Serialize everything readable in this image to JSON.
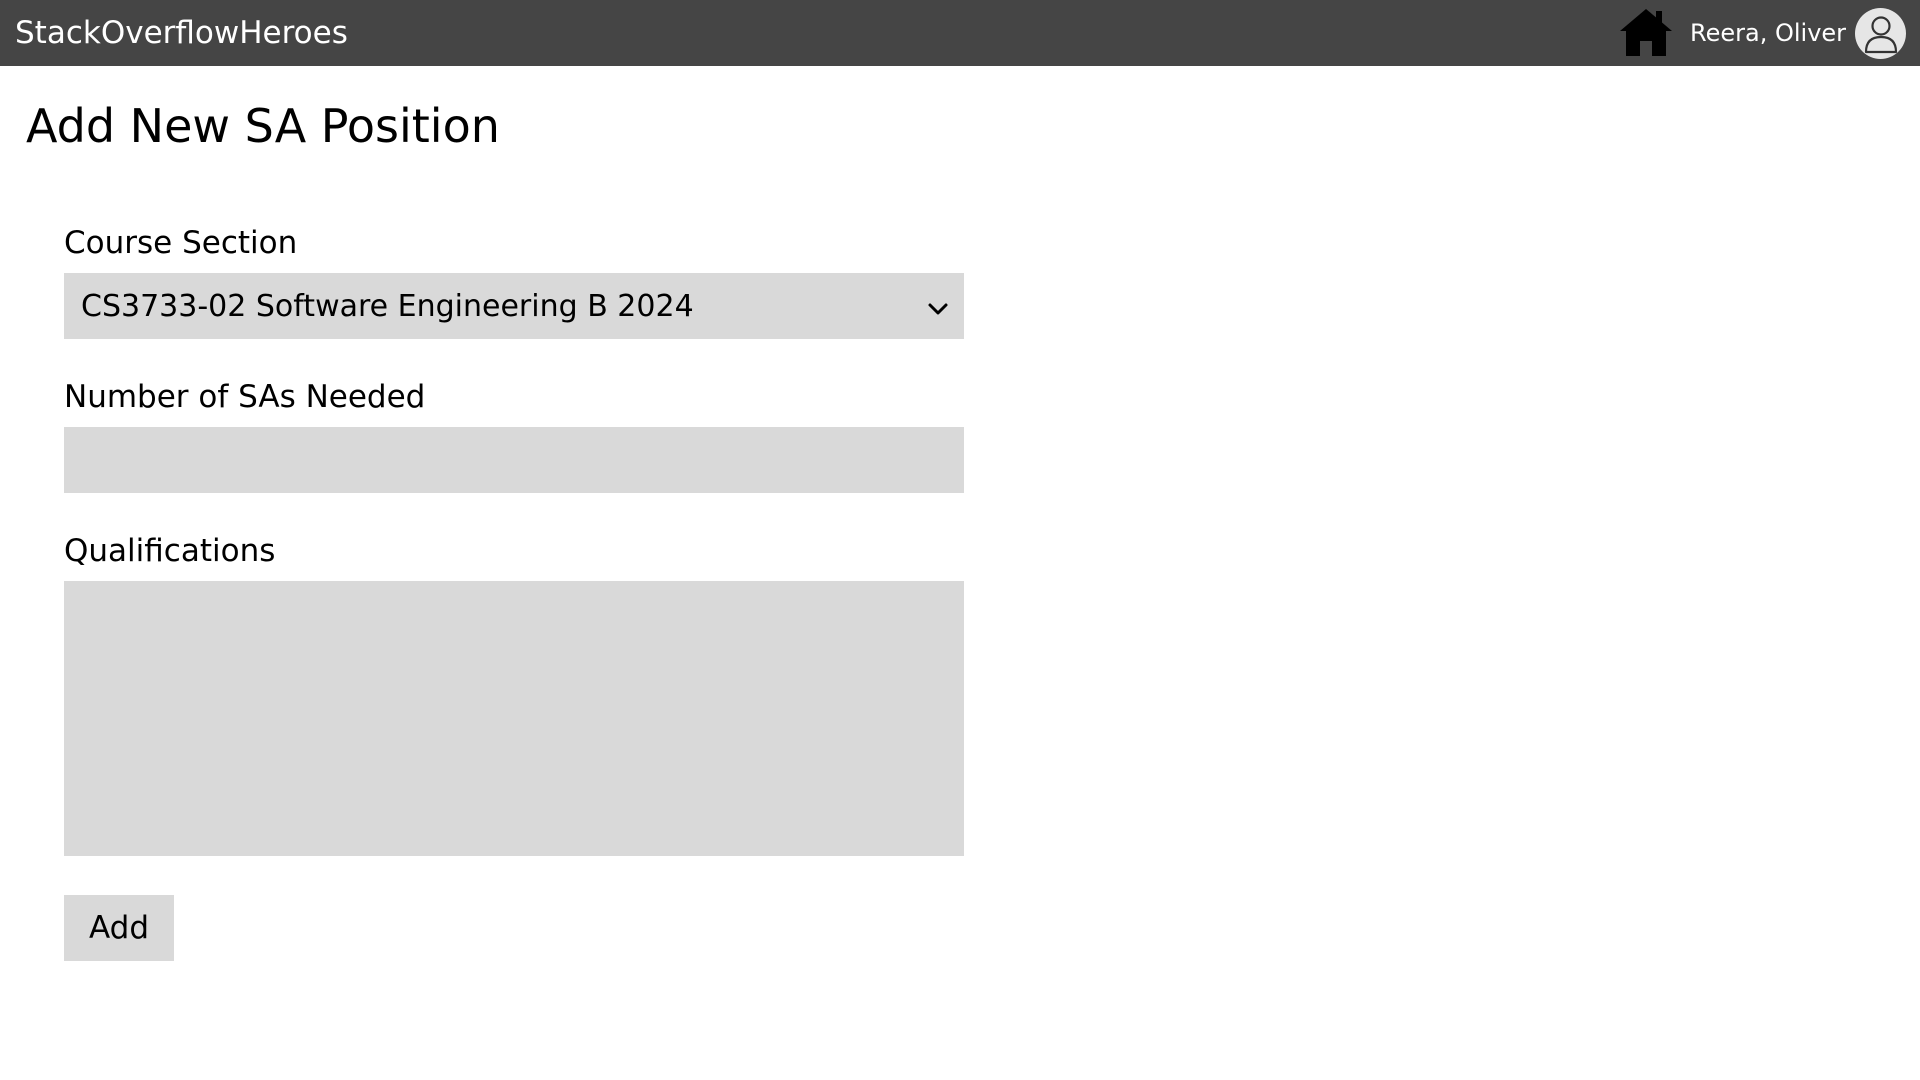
{
  "header": {
    "app_title": "StackOverflowHeroes",
    "home_icon": "home-icon",
    "user_name": "Reera, Oliver",
    "avatar_icon": "user-avatar-icon",
    "background": "#454545"
  },
  "page": {
    "title": "Add New SA Position"
  },
  "form": {
    "course_section": {
      "label": "Course Section",
      "selected_value": "CS3733-02 Software Engineering B 2024",
      "icon": "chevron-down-icon"
    },
    "num_sas": {
      "label": "Number of SAs Needed",
      "value": "",
      "placeholder": ""
    },
    "qualifications": {
      "label": "Qualifications",
      "value": "",
      "placeholder": ""
    },
    "add_button_label": "Add",
    "field_background": "#d9d9d9"
  }
}
